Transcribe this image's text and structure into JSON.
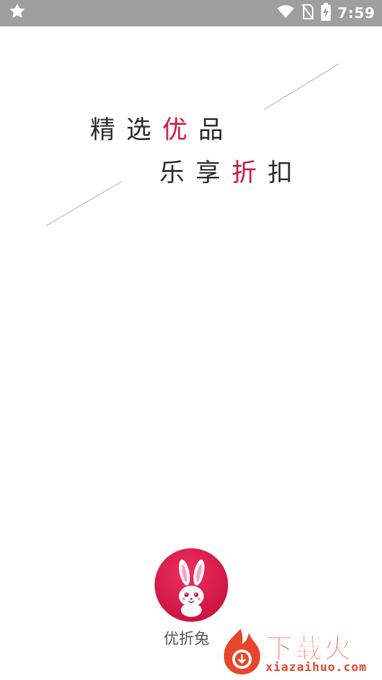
{
  "status_bar": {
    "time": "7:59",
    "icons": [
      "star-icon",
      "wifi-icon",
      "no-sim-icon",
      "battery-charging-icon"
    ],
    "background": "#9e9e9e"
  },
  "splash": {
    "slogan_line1": {
      "part1": "精选",
      "highlight": "优",
      "part2": "品"
    },
    "slogan_line2": {
      "part1": "乐享",
      "highlight": "折",
      "part2": "扣"
    },
    "highlight_color": "#d1163d",
    "text_color": "#2b2b2b"
  },
  "app": {
    "name": "优折兔",
    "logo_color": "#e01a4f",
    "logo_icon": "rabbit-icon"
  },
  "watermark": {
    "title": "下载火",
    "url": "xiazaihuo.com",
    "color": "#e8452a"
  }
}
